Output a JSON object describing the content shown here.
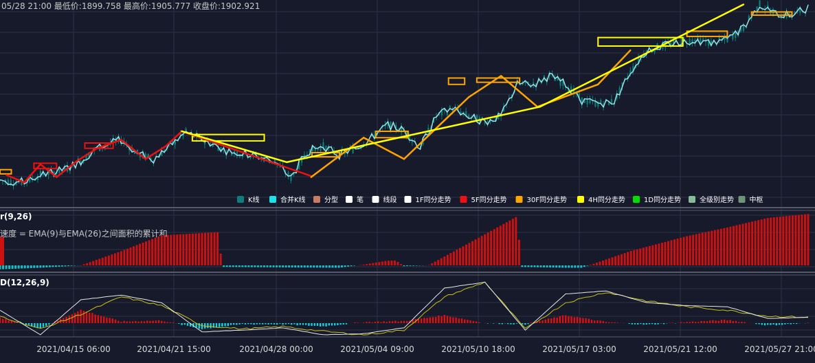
{
  "header": {
    "info": "05/28 21:00 最低价:1899.758 最高价:1905.777 收盘价:1902.921"
  },
  "legend": [
    {
      "label": "K线",
      "color": "#0c7e7b"
    },
    {
      "label": "合并K线",
      "color": "#1de1ea"
    },
    {
      "label": "分型",
      "color": "#c97b63"
    },
    {
      "label": "笔",
      "color": "#ffffff"
    },
    {
      "label": "线段",
      "color": "#ffffff"
    },
    {
      "label": "1F同分走势",
      "color": "#ffffff"
    },
    {
      "label": "5F同分走势",
      "color": "#ee1111"
    },
    {
      "label": "30F同分走势",
      "color": "#ffa500"
    },
    {
      "label": "4H同分走势",
      "color": "#ffff00"
    },
    {
      "label": "1D同分走势",
      "color": "#00e000"
    },
    {
      "label": "全级别走势",
      "color": "#88bb99"
    },
    {
      "label": "中枢",
      "color": "#6f9477"
    }
  ],
  "panel2": {
    "title": "r(9,26)",
    "subtitle": "速度 = EMA(9)与EMA(26)之间面积的累计和"
  },
  "panel3": {
    "title": "D(12,26,9)"
  },
  "x_ticks": [
    "2021/04/15 06:00",
    "2021/04/21 15:00",
    "2021/04/28 00:00",
    "2021/05/04 09:00",
    "2021/05/10 18:00",
    "2021/05/17 03:00",
    "2021/05/21 12:00",
    "2021/05/27 21:00"
  ],
  "colors": {
    "bg": "#161a2b",
    "grid": "#2d3246",
    "candle": "#0c7e7b",
    "merged": "#1de1ea",
    "up": "#ee1111",
    "down": "#1de1ea",
    "dif": "#e8e8e8",
    "dea": "#c9c11a"
  },
  "chart_data": {
    "type": "line",
    "title": "",
    "price_path": [
      [
        0,
        1740
      ],
      [
        0.03,
        1738
      ],
      [
        0.05,
        1745
      ],
      [
        0.08,
        1750
      ],
      [
        0.1,
        1758
      ],
      [
        0.12,
        1770
      ],
      [
        0.15,
        1778
      ],
      [
        0.17,
        1765
      ],
      [
        0.19,
        1760
      ],
      [
        0.21,
        1772
      ],
      [
        0.23,
        1785
      ],
      [
        0.26,
        1775
      ],
      [
        0.28,
        1768
      ],
      [
        0.31,
        1764
      ],
      [
        0.34,
        1758
      ],
      [
        0.36,
        1742
      ],
      [
        0.38,
        1767
      ],
      [
        0.4,
        1772
      ],
      [
        0.42,
        1764
      ],
      [
        0.44,
        1770
      ],
      [
        0.46,
        1780
      ],
      [
        0.48,
        1792
      ],
      [
        0.5,
        1787
      ],
      [
        0.52,
        1771
      ],
      [
        0.54,
        1800
      ],
      [
        0.56,
        1808
      ],
      [
        0.58,
        1800
      ],
      [
        0.6,
        1795
      ],
      [
        0.62,
        1800
      ],
      [
        0.64,
        1830
      ],
      [
        0.66,
        1830
      ],
      [
        0.68,
        1838
      ],
      [
        0.7,
        1830
      ],
      [
        0.72,
        1815
      ],
      [
        0.74,
        1812
      ],
      [
        0.76,
        1814
      ],
      [
        0.78,
        1842
      ],
      [
        0.8,
        1862
      ],
      [
        0.82,
        1866
      ],
      [
        0.84,
        1870
      ],
      [
        0.86,
        1872
      ],
      [
        0.88,
        1869
      ],
      [
        0.9,
        1872
      ],
      [
        0.92,
        1883
      ],
      [
        0.94,
        1905
      ],
      [
        0.96,
        1896
      ],
      [
        0.98,
        1895
      ],
      [
        1.0,
        1902
      ]
    ],
    "bi_5f": [
      [
        0.008,
        1745
      ],
      [
        0.03,
        1738
      ],
      [
        0.05,
        1755
      ],
      [
        0.07,
        1743
      ],
      [
        0.095,
        1758
      ],
      [
        0.12,
        1770
      ],
      [
        0.15,
        1778
      ],
      [
        0.18,
        1760
      ],
      [
        0.205,
        1772
      ],
      [
        0.225,
        1786
      ],
      [
        0.385,
        1744
      ]
    ],
    "bi_30f": [
      [
        0.385,
        1743
      ],
      [
        0.45,
        1780
      ],
      [
        0.5,
        1760
      ],
      [
        0.58,
        1818
      ],
      [
        0.62,
        1838
      ],
      [
        0.665,
        1809
      ],
      [
        0.74,
        1830
      ],
      [
        0.78,
        1862
      ]
    ],
    "bi_4h": [
      [
        0.225,
        1786
      ],
      [
        0.355,
        1757
      ],
      [
        0.668,
        1809
      ],
      [
        0.92,
        1905
      ]
    ],
    "zhongshu": [
      {
        "x0": 0.0,
        "x1": 0.014,
        "y0": 1746,
        "y1": 1750,
        "color": "#ffa500"
      },
      {
        "x0": 0.042,
        "x1": 0.07,
        "y0": 1751,
        "y1": 1756,
        "color": "#ee1111"
      },
      {
        "x0": 0.105,
        "x1": 0.14,
        "y0": 1770,
        "y1": 1775,
        "color": "#ee1111"
      },
      {
        "x0": 0.238,
        "x1": 0.327,
        "y0": 1777,
        "y1": 1783,
        "color": "#ffff00"
      },
      {
        "x0": 0.386,
        "x1": 0.42,
        "y0": 1762,
        "y1": 1766,
        "color": "#ffa500"
      },
      {
        "x0": 0.465,
        "x1": 0.505,
        "y0": 1780,
        "y1": 1786,
        "color": "#ffa500"
      },
      {
        "x0": 0.555,
        "x1": 0.575,
        "y0": 1830,
        "y1": 1836,
        "color": "#ffa500"
      },
      {
        "x0": 0.59,
        "x1": 0.643,
        "y0": 1832,
        "y1": 1836,
        "color": "#ffa500"
      },
      {
        "x0": 0.74,
        "x1": 0.845,
        "y0": 1866,
        "y1": 1874,
        "color": "#ffff00"
      },
      {
        "x0": 0.85,
        "x1": 0.9,
        "y0": 1875,
        "y1": 1880,
        "color": "#ffa500"
      },
      {
        "x0": 0.93,
        "x1": 0.98,
        "y0": 1895,
        "y1": 1898,
        "color": "#ffa500"
      }
    ],
    "speed_bars_outline": [
      [
        0,
        -5
      ],
      [
        0.05,
        -3
      ],
      [
        0.1,
        0
      ],
      [
        0.15,
        18
      ],
      [
        0.2,
        38
      ],
      [
        0.27,
        42
      ],
      [
        0.275,
        -2
      ],
      [
        0.42,
        -3
      ],
      [
        0.45,
        1
      ],
      [
        0.48,
        6
      ],
      [
        0.49,
        6
      ],
      [
        0.5,
        -1
      ],
      [
        0.53,
        0
      ],
      [
        0.58,
        28
      ],
      [
        0.64,
        62
      ],
      [
        0.645,
        -2
      ],
      [
        0.7,
        -3
      ],
      [
        0.72,
        -3
      ],
      [
        0.78,
        18
      ],
      [
        0.85,
        37
      ],
      [
        0.9,
        48
      ],
      [
        0.95,
        60
      ],
      [
        1.0,
        65
      ]
    ],
    "macd_dif": [
      [
        0,
        22
      ],
      [
        0.05,
        -20
      ],
      [
        0.1,
        40
      ],
      [
        0.15,
        48
      ],
      [
        0.2,
        35
      ],
      [
        0.25,
        -15
      ],
      [
        0.3,
        -12
      ],
      [
        0.35,
        -8
      ],
      [
        0.4,
        -20
      ],
      [
        0.45,
        -18
      ],
      [
        0.5,
        -8
      ],
      [
        0.55,
        60
      ],
      [
        0.6,
        70
      ],
      [
        0.65,
        -12
      ],
      [
        0.7,
        50
      ],
      [
        0.75,
        55
      ],
      [
        0.8,
        35
      ],
      [
        0.85,
        30
      ],
      [
        0.9,
        28
      ],
      [
        0.95,
        8
      ],
      [
        1.0,
        10
      ]
    ],
    "macd_dea": [
      [
        0,
        12
      ],
      [
        0.05,
        -10
      ],
      [
        0.1,
        15
      ],
      [
        0.15,
        45
      ],
      [
        0.2,
        30
      ],
      [
        0.25,
        -4
      ],
      [
        0.3,
        -10
      ],
      [
        0.35,
        -6
      ],
      [
        0.4,
        -14
      ],
      [
        0.45,
        -20
      ],
      [
        0.5,
        -12
      ],
      [
        0.55,
        45
      ],
      [
        0.6,
        70
      ],
      [
        0.65,
        -10
      ],
      [
        0.7,
        35
      ],
      [
        0.75,
        53
      ],
      [
        0.8,
        38
      ],
      [
        0.85,
        28
      ],
      [
        0.9,
        22
      ],
      [
        0.95,
        12
      ],
      [
        1.0,
        10
      ]
    ]
  }
}
